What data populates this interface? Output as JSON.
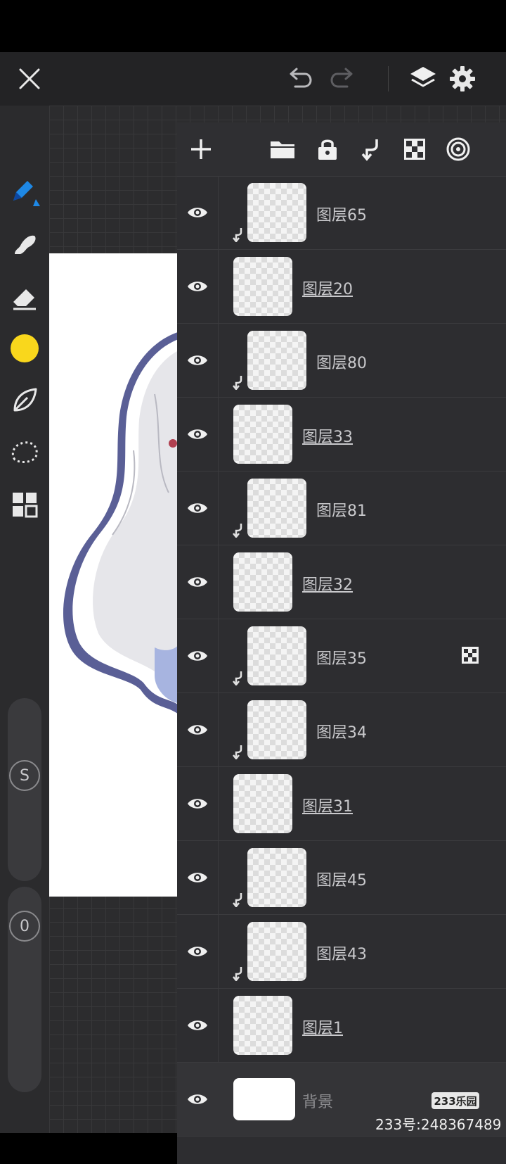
{
  "layers": [
    {
      "name": "图层65",
      "clip": true
    },
    {
      "name": "图层20",
      "clip": false
    },
    {
      "name": "图层80",
      "clip": true
    },
    {
      "name": "图层33",
      "clip": false
    },
    {
      "name": "图层81",
      "clip": true
    },
    {
      "name": "图层32",
      "clip": false
    },
    {
      "name": "图层35",
      "clip": true,
      "alpha_lock": true
    },
    {
      "name": "图层34",
      "clip": true
    },
    {
      "name": "图层31",
      "clip": false
    },
    {
      "name": "图层45",
      "clip": true
    },
    {
      "name": "图层43",
      "clip": true
    },
    {
      "name": "图层1",
      "clip": false
    }
  ],
  "background_layer": {
    "name": "背景"
  },
  "sliders": {
    "size_label": "S",
    "opacity_label": "0"
  },
  "colors": {
    "current_color": "#f9d71c",
    "accent": "#1e88e5"
  },
  "watermark": {
    "badge": "233乐园",
    "text": "233号:248367489"
  }
}
